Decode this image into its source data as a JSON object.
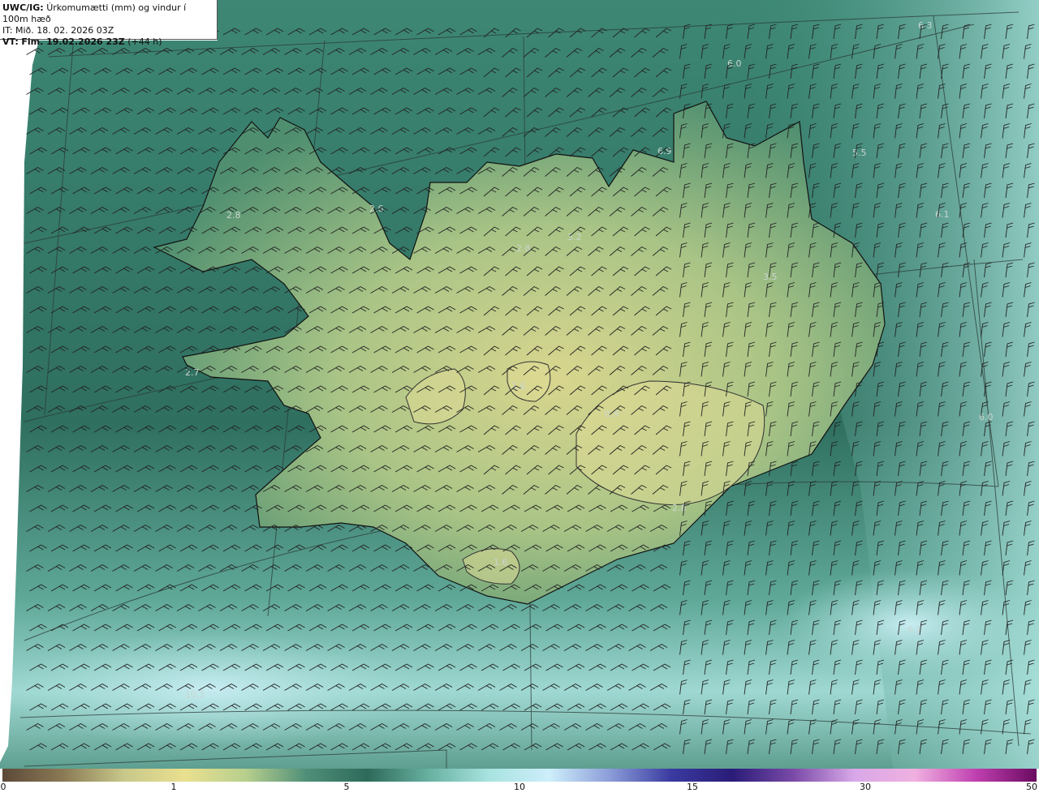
{
  "header": {
    "product": "UWC/IG:",
    "title": "Úrkomumætti (mm) og vindur í 100m hæð",
    "it_label": "IT:",
    "it_value": "Mið. 18. 02. 2026 03Z",
    "vt_label": "VT:",
    "vt_value": "Fim. 19.02.2026 23Z",
    "lead": "(+44 h)"
  },
  "value_labels": [
    {
      "text": "6.3"
    },
    {
      "text": "6.0"
    },
    {
      "text": "6.9"
    },
    {
      "text": "5.5"
    },
    {
      "text": "6.1"
    },
    {
      "text": "2.8"
    },
    {
      "text": "2.6"
    },
    {
      "text": "2.8"
    },
    {
      "text": "3.2"
    },
    {
      "text": "3.5"
    },
    {
      "text": "2.7"
    },
    {
      "text": "1.6"
    },
    {
      "text": "0.9"
    },
    {
      "text": "6.0"
    },
    {
      "text": "2.8"
    },
    {
      "text": "1.6"
    },
    {
      "text": "6.1"
    },
    {
      "text": "10.5"
    }
  ],
  "colorbar": {
    "ticks": [
      "0",
      "1",
      "5",
      "10",
      "15",
      "30",
      "50"
    ],
    "colors": [
      "#5c4a38",
      "#8a7a55",
      "#c8c88a",
      "#e9e08f",
      "#b7cf8d",
      "#4f8f78",
      "#2e6a5a",
      "#67b0a0",
      "#a8e3e0",
      "#cdeefa",
      "#8a9bd8",
      "#3a3aa0",
      "#2a1c78",
      "#7a4aa8",
      "#d8a8e8",
      "#f0b0e0",
      "#c040b0",
      "#6a0a60"
    ]
  },
  "map": {
    "background_colors": {
      "sea_dark": "#2f6f5f",
      "sea_mid": "#4f9a8a",
      "sea_light": "#a6ddd6",
      "land_low": "#5a9a72",
      "land_high": "#d8d890"
    },
    "barb_color": "#222222",
    "coast_color": "#111111"
  }
}
